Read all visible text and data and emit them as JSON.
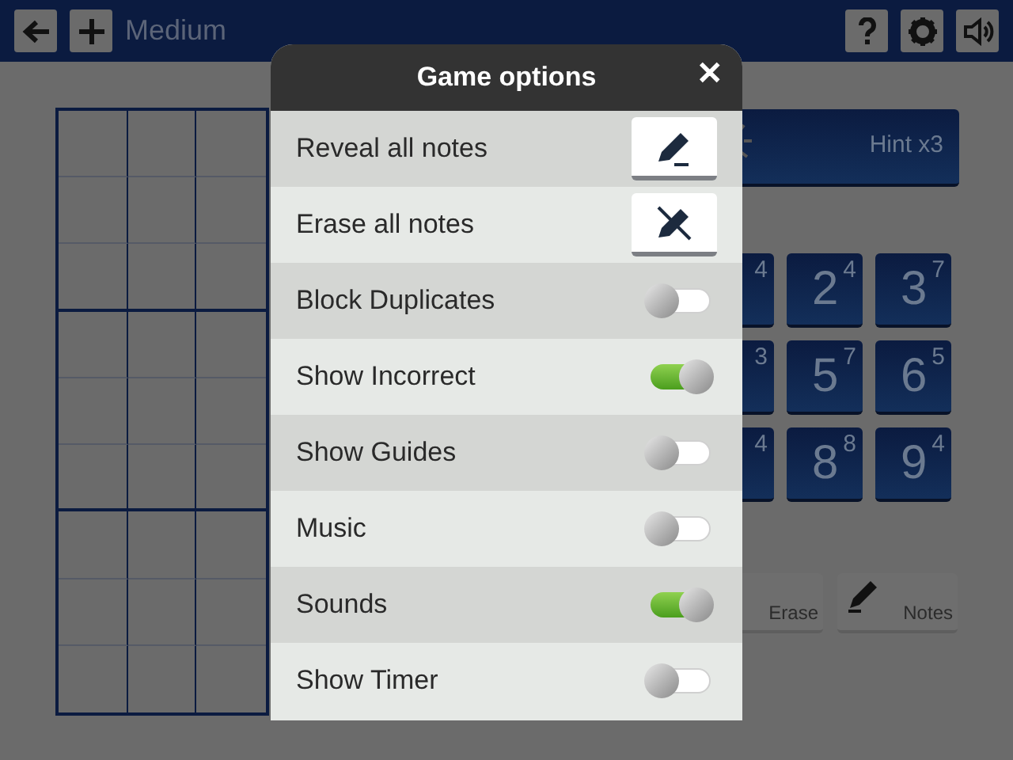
{
  "header": {
    "title": "Medium"
  },
  "hint_button": {
    "label": "Hint x3"
  },
  "number_keys": [
    {
      "count": "4"
    },
    {
      "digit": "2",
      "count": "4"
    },
    {
      "digit": "3",
      "count": "7"
    },
    {
      "count": "3"
    },
    {
      "digit": "5",
      "count": "7"
    },
    {
      "digit": "6",
      "count": "5"
    },
    {
      "count": "4"
    },
    {
      "digit": "8",
      "count": "8"
    },
    {
      "digit": "9",
      "count": "4"
    }
  ],
  "tool_buttons": [
    {
      "label": "Erase"
    },
    {
      "label": "Notes"
    }
  ],
  "dialog": {
    "title": "Game options",
    "close": "✕",
    "options": [
      {
        "kind": "action",
        "label": "Reveal all notes"
      },
      {
        "kind": "action",
        "label": "Erase all notes"
      },
      {
        "kind": "toggle",
        "label": "Block Duplicates",
        "on": false
      },
      {
        "kind": "toggle",
        "label": "Show Incorrect",
        "on": true
      },
      {
        "kind": "toggle",
        "label": "Show Guides",
        "on": false
      },
      {
        "kind": "toggle",
        "label": "Music",
        "on": false
      },
      {
        "kind": "toggle",
        "label": "Sounds",
        "on": true
      },
      {
        "kind": "toggle",
        "label": "Show Timer",
        "on": false
      }
    ]
  }
}
